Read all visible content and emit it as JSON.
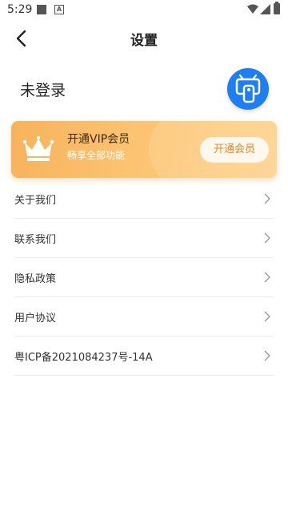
{
  "status_bar": {
    "time": "5:29",
    "notif_icon_letter": "A"
  },
  "header": {
    "title": "设置"
  },
  "profile": {
    "login_status": "未登录"
  },
  "vip": {
    "title": "开通VIP会员",
    "subtitle": "畅享全部功能",
    "button_label": "开通会员"
  },
  "menu": [
    {
      "label": "关于我们"
    },
    {
      "label": "联系我们"
    },
    {
      "label": "隐私政策"
    },
    {
      "label": "用户协议"
    },
    {
      "label": "粤ICP备2021084237号-14A"
    }
  ],
  "colors": {
    "accent": "#1f7ff2",
    "vip_gradient_start": "#f7b25c",
    "vip_gradient_end": "#ffd28a",
    "vip_button_text": "#e68a25"
  }
}
